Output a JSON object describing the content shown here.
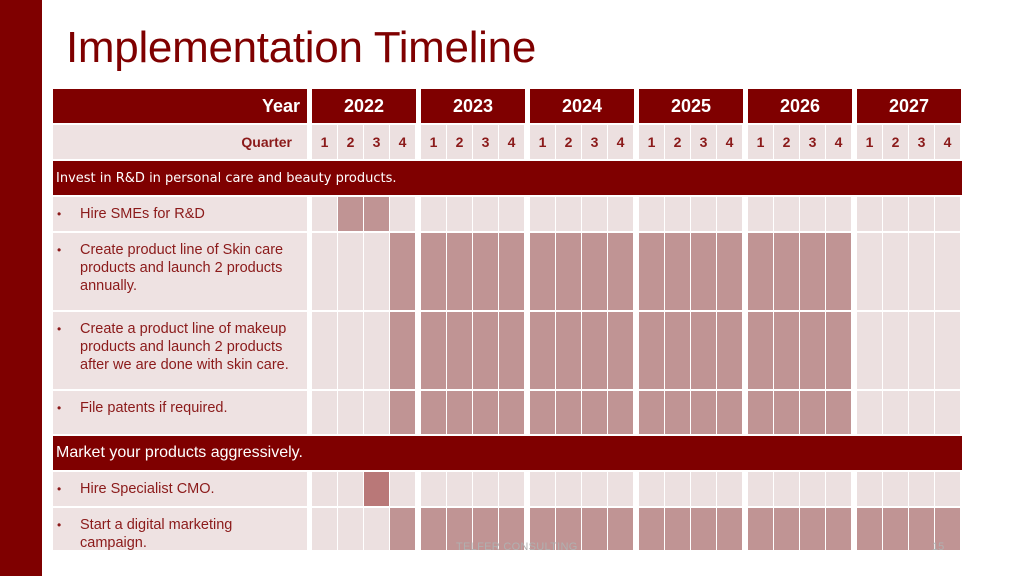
{
  "slide": {
    "title": "Implementation Timeline",
    "footer_text": "TELFER CONSULTING",
    "page_number": "15",
    "accent_color": "#7f0000"
  },
  "header": {
    "year_label": "Year",
    "quarter_label": "Quarter",
    "years": [
      "2022",
      "2023",
      "2024",
      "2025",
      "2026",
      "2027"
    ],
    "quarters": [
      "1",
      "2",
      "3",
      "4"
    ]
  },
  "sections": [
    {
      "title": "Invest in R&D in personal care and beauty products.",
      "tasks": [
        {
          "bullet": "•",
          "label": "Hire SMEs for R&D",
          "active": [
            {
              "start": "2022 Q2",
              "end": "2022 Q3"
            }
          ]
        },
        {
          "bullet": "•",
          "label": "Create product line of Skin care products and launch 2 products annually.",
          "active": [
            {
              "start": "2022 Q4",
              "end": "2026 Q4"
            }
          ]
        },
        {
          "bullet": "•",
          "label": "Create a product line of makeup products and launch 2 products after we are done with skin care.",
          "active": [
            {
              "start": "2022 Q4",
              "end": "2026 Q4"
            }
          ]
        },
        {
          "bullet": "•",
          "label": "File patents if required.",
          "active": [
            {
              "start": "2022 Q4",
              "end": "2026 Q4"
            }
          ]
        }
      ]
    },
    {
      "title": "Market your products aggressively.",
      "tasks": [
        {
          "bullet": "•",
          "label": "Hire Specialist CMO.",
          "active": [
            {
              "start": "2022 Q3",
              "end": "2022 Q3",
              "emphasis": true
            }
          ]
        },
        {
          "bullet": "•",
          "label": "Start a digital marketing campaign.",
          "active": [
            {
              "start": "2022 Q4",
              "end": "2027 Q4"
            }
          ]
        }
      ]
    }
  ]
}
